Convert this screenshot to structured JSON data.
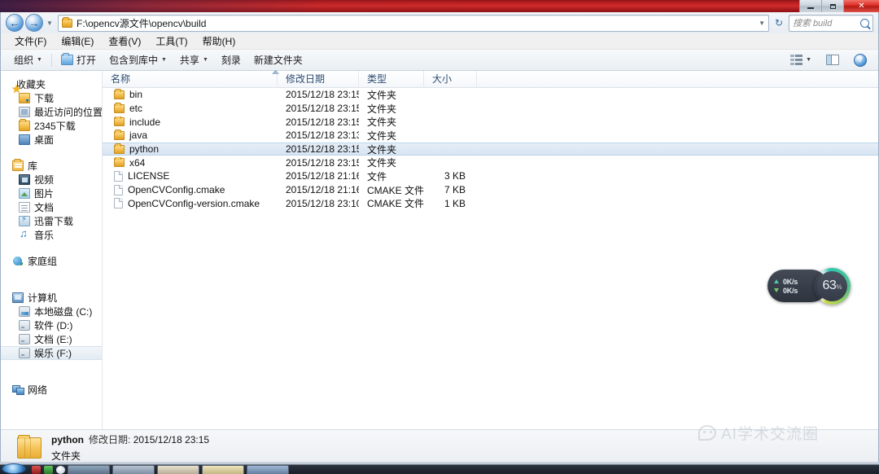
{
  "window": {
    "controls": {
      "minimize": "–",
      "maximize": "□",
      "close": "✕"
    }
  },
  "addressbar": {
    "back_icon": "←",
    "forward_icon": "→",
    "history_caret": "▼",
    "path": "F:\\opencv源文件\\opencv\\build",
    "path_caret": "▼",
    "refresh_icon": "↻",
    "search_placeholder": "搜索 build"
  },
  "menubar": {
    "items": [
      {
        "label": "文件(F)"
      },
      {
        "label": "编辑(E)"
      },
      {
        "label": "查看(V)"
      },
      {
        "label": "工具(T)"
      },
      {
        "label": "帮助(H)"
      }
    ]
  },
  "toolbar": {
    "organize": "组织",
    "open": "打开",
    "include_in_library": "包含到库中",
    "share": "共享",
    "burn": "刻录",
    "new_folder": "新建文件夹",
    "caret": "▼",
    "help_glyph": "?"
  },
  "navpane": {
    "groups": [
      {
        "root": {
          "label": "收藏夹",
          "icon": "star-icon"
        },
        "children": [
          {
            "label": "下载",
            "icon": "downloads-icon"
          },
          {
            "label": "最近访问的位置",
            "icon": "recent-places-icon"
          },
          {
            "label": "2345下载",
            "icon": "folder-icon"
          },
          {
            "label": "桌面",
            "icon": "desktop-icon"
          }
        ]
      },
      {
        "root": {
          "label": "库",
          "icon": "library-icon"
        },
        "children": [
          {
            "label": "视频",
            "icon": "video-icon"
          },
          {
            "label": "图片",
            "icon": "pictures-icon"
          },
          {
            "label": "文档",
            "icon": "documents-icon"
          },
          {
            "label": "迅雷下载",
            "icon": "thunder-download-icon"
          },
          {
            "label": "音乐",
            "icon": "music-icon"
          }
        ]
      },
      {
        "root": {
          "label": "家庭组",
          "icon": "homegroup-icon"
        },
        "children": []
      },
      {
        "root": {
          "label": "计算机",
          "icon": "computer-icon"
        },
        "children": [
          {
            "label": "本地磁盘 (C:)",
            "icon": "system-drive-icon"
          },
          {
            "label": "软件 (D:)",
            "icon": "drive-icon"
          },
          {
            "label": "文档 (E:)",
            "icon": "drive-icon"
          },
          {
            "label": "娱乐 (F:)",
            "icon": "drive-icon",
            "highlighted": true
          }
        ]
      },
      {
        "root": {
          "label": "网络",
          "icon": "network-icon"
        },
        "children": []
      }
    ]
  },
  "filelist": {
    "columns": [
      {
        "key": "name",
        "label": "名称"
      },
      {
        "key": "date",
        "label": "修改日期"
      },
      {
        "key": "type",
        "label": "类型"
      },
      {
        "key": "size",
        "label": "大小"
      }
    ],
    "rows": [
      {
        "name": "bin",
        "date": "2015/12/18 23:15",
        "type": "文件夹",
        "size": "",
        "kind": "folder",
        "selected": false
      },
      {
        "name": "etc",
        "date": "2015/12/18 23:15",
        "type": "文件夹",
        "size": "",
        "kind": "folder",
        "selected": false
      },
      {
        "name": "include",
        "date": "2015/12/18 23:15",
        "type": "文件夹",
        "size": "",
        "kind": "folder",
        "selected": false
      },
      {
        "name": "java",
        "date": "2015/12/18 23:13",
        "type": "文件夹",
        "size": "",
        "kind": "folder",
        "selected": false
      },
      {
        "name": "python",
        "date": "2015/12/18 23:15",
        "type": "文件夹",
        "size": "",
        "kind": "folder",
        "selected": true
      },
      {
        "name": "x64",
        "date": "2015/12/18 23:15",
        "type": "文件夹",
        "size": "",
        "kind": "folder",
        "selected": false
      },
      {
        "name": "LICENSE",
        "date": "2015/12/18 21:16",
        "type": "文件",
        "size": "3 KB",
        "kind": "file",
        "selected": false
      },
      {
        "name": "OpenCVConfig.cmake",
        "date": "2015/12/18 21:16",
        "type": "CMAKE 文件",
        "size": "7 KB",
        "kind": "file",
        "selected": false
      },
      {
        "name": "OpenCVConfig-version.cmake",
        "date": "2015/12/18 23:10",
        "type": "CMAKE 文件",
        "size": "1 KB",
        "kind": "file",
        "selected": false
      }
    ]
  },
  "statusbar": {
    "item_name": "python",
    "date_label": "修改日期:",
    "date_value": "2015/12/18 23:15",
    "item_type": "文件夹"
  },
  "netwidget": {
    "upload_speed": "0K/s",
    "download_speed": "0K/s",
    "gauge_value": "63",
    "gauge_unit": "%"
  },
  "watermark": {
    "text": "AI学术交流圈"
  },
  "colors": {
    "titlebar_red": "#c0272b",
    "selection_blue": "#d6e4f2",
    "column_header_text": "#2e4c72",
    "gauge_teal": "#37c9a5",
    "gauge_lime": "#cfd84e"
  }
}
